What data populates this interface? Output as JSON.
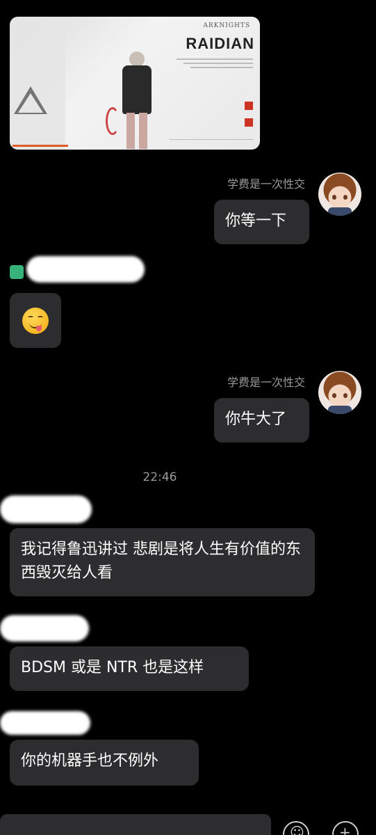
{
  "image_card": {
    "brand": "ARKNIGHTS",
    "title": "RAIDIAN"
  },
  "messages": [
    {
      "id": "m1",
      "side": "right",
      "sender": "学费是一次性交",
      "text": "你等一下"
    },
    {
      "id": "m2",
      "side": "left",
      "emoji": "face-savoring-food-emoji"
    },
    {
      "id": "m3",
      "side": "right",
      "sender": "学费是一次性交",
      "text": "你牛大了"
    },
    {
      "id": "m4",
      "side": "left",
      "text": "我记得鲁迅讲过 悲剧是将人生有价值的东西毁灭给人看"
    },
    {
      "id": "m5",
      "side": "left",
      "text": "BDSM 或是 NTR 也是这样"
    },
    {
      "id": "m6",
      "side": "left",
      "text": "你的机器手也不例外"
    }
  ],
  "timestamp": "22:46",
  "bottom_bar": {
    "left_button_icon": "emoji-icon",
    "right_button_icon": "add-icon"
  }
}
